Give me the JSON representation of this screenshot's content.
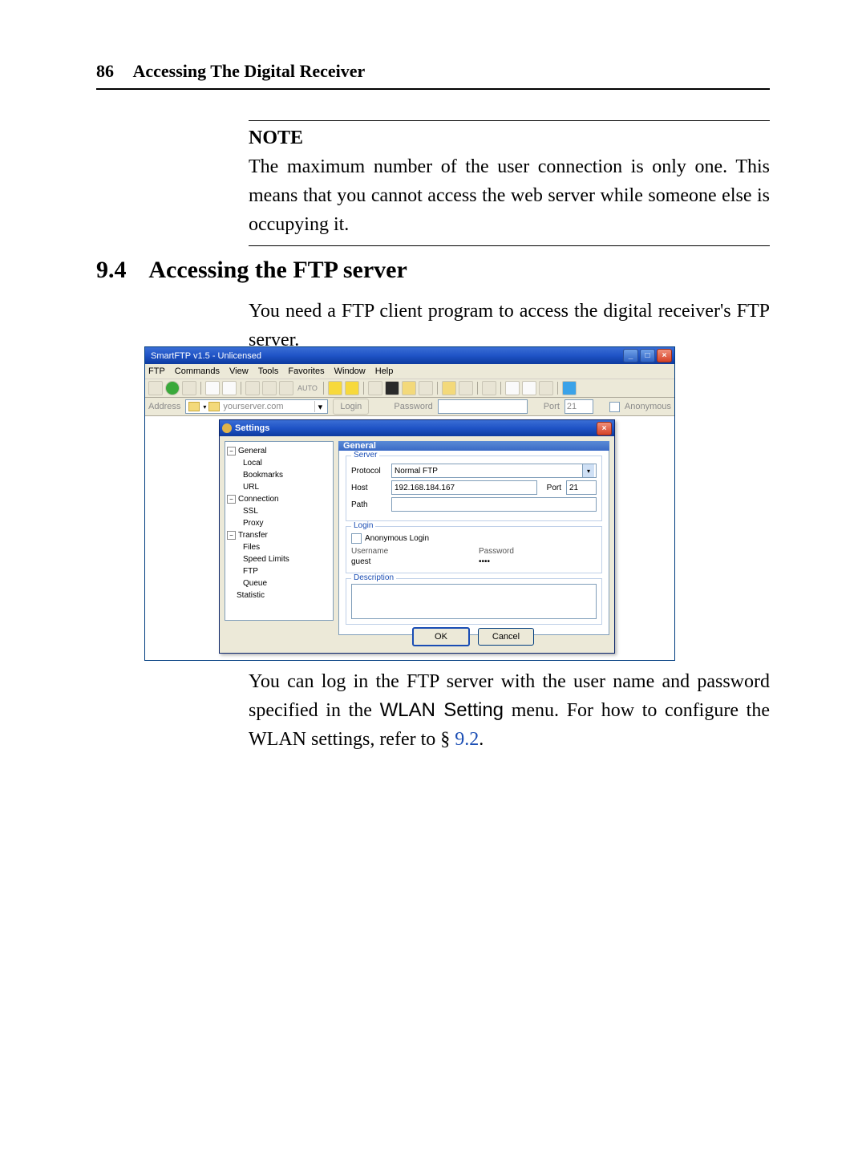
{
  "header": {
    "pagenum": "86",
    "chapter": "Accessing The Digital Receiver"
  },
  "note": {
    "title": "NOTE",
    "body": "The maximum number of the user connection is only one. This means that you cannot access the web server while someone else is occupying it."
  },
  "section": {
    "number": "9.4",
    "title": "Accessing the FTP server"
  },
  "para1": "You need a FTP client program to access the digital receiver's FTP server.",
  "para2_pre": "You can log in the FTP server with the user name and password specified in the ",
  "para2_sans": "WLAN Setting",
  "para2_mid": " menu. For how to configure the WLAN settings, refer to § ",
  "para2_link": "9.2",
  "para2_post": ".",
  "app": {
    "title": "SmartFTP v1.5 - Unlicensed",
    "menu": [
      "FTP",
      "Commands",
      "View",
      "Tools",
      "Favorites",
      "Window",
      "Help"
    ],
    "toolbar_auto": "AUTO",
    "addressbar": {
      "label_address": "Address",
      "address_value": "yourserver.com",
      "login_btn": "Login",
      "label_password": "Password",
      "label_port": "Port",
      "port_value": "21",
      "anonymous_label": "Anonymous"
    },
    "settings": {
      "title": "Settings",
      "tree": {
        "general": "General",
        "general_children": [
          "Local",
          "Bookmarks",
          "URL"
        ],
        "connection": "Connection",
        "connection_children": [
          "SSL",
          "Proxy"
        ],
        "transfer": "Transfer",
        "transfer_children": [
          "Files",
          "Speed Limits",
          "FTP",
          "Queue"
        ],
        "statistic": "Statistic"
      },
      "panel": {
        "header": "General",
        "server_legend": "Server",
        "protocol_label": "Protocol",
        "protocol_value": "Normal FTP",
        "host_label": "Host",
        "host_value": "192.168.184.167",
        "port_label": "Port",
        "port_value": "21",
        "path_label": "Path",
        "login_legend": "Login",
        "anonymous_login": "Anonymous Login",
        "username_label": "Username",
        "username_value": "guest",
        "password_label": "Password",
        "password_value": "••••",
        "description_legend": "Description"
      },
      "buttons": {
        "ok": "OK",
        "cancel": "Cancel"
      }
    },
    "winbtns": {
      "min": "_",
      "max": "□",
      "close": "×"
    }
  }
}
